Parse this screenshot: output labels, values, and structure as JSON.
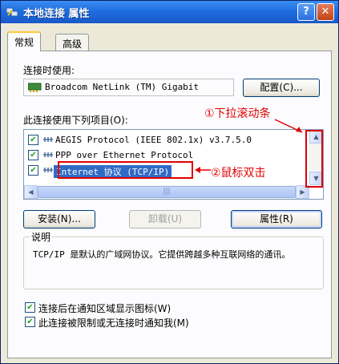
{
  "window": {
    "title": "本地连接 属性",
    "help_label": "?",
    "close_label": "✕"
  },
  "tabs": [
    {
      "label": "常规",
      "selected": true
    },
    {
      "label": "高级",
      "selected": false
    }
  ],
  "connect_using": {
    "label": "连接时使用:",
    "adapter": "Broadcom NetLink (TM) Gigabit",
    "configure_label": "配置(C)..."
  },
  "items_label": "此连接使用下列项目(O):",
  "items": [
    {
      "label": "AEGIS Protocol (IEEE 802.1x) v3.7.5.0",
      "checked": true,
      "icon": "protocol-icon"
    },
    {
      "label": "PPP over Ethernet Protocol",
      "checked": true,
      "icon": "protocol-icon"
    },
    {
      "label": "Internet 协议 (TCP/IP)",
      "checked": true,
      "selected": true,
      "icon": "protocol-icon"
    }
  ],
  "scroll": {
    "up": "▲",
    "down": "▼",
    "left": "◀",
    "right": "▶",
    "grip": "|||"
  },
  "annotations": {
    "scroll_hint": "①下拉滚动条",
    "double_click_hint": "②鼠标双击"
  },
  "buttons": {
    "install": "安装(N)...",
    "uninstall": "卸载(U)",
    "properties": "属性(R)"
  },
  "description": {
    "title": "说明",
    "text": "TCP/IP 是默认的广域网协议。它提供跨越多种互联网络的通讯。"
  },
  "options": [
    {
      "label": "连接后在通知区域显示图标(W)",
      "checked": true
    },
    {
      "label": "此连接被限制或无连接时通知我(M)",
      "checked": true
    }
  ],
  "colors": {
    "titlebar": "#1f6ee0",
    "selection": "#316ac5",
    "annotation": "#e00000"
  }
}
